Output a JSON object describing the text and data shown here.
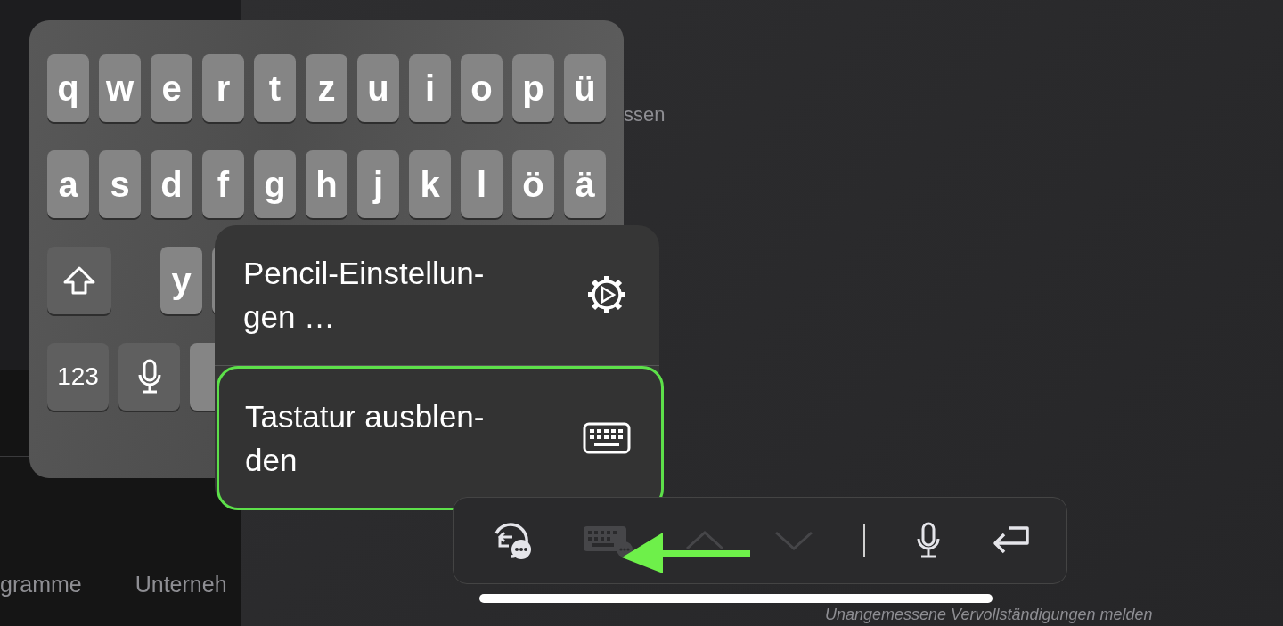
{
  "background": {
    "partial_text": "ssen",
    "nav_items": [
      "gramme",
      "Unterneh"
    ],
    "footer_link": "Unangemessene Vervollständigungen melden"
  },
  "keyboard": {
    "rows": [
      {
        "keys": [
          {
            "kind": "char",
            "label": "q"
          },
          {
            "kind": "char",
            "label": "w"
          },
          {
            "kind": "char",
            "label": "e"
          },
          {
            "kind": "char",
            "label": "r"
          },
          {
            "kind": "char",
            "label": "t"
          },
          {
            "kind": "char",
            "label": "z"
          },
          {
            "kind": "char",
            "label": "u"
          },
          {
            "kind": "char",
            "label": "i"
          },
          {
            "kind": "char",
            "label": "o"
          },
          {
            "kind": "char",
            "label": "p"
          },
          {
            "kind": "char",
            "label": "ü"
          }
        ]
      },
      {
        "keys": [
          {
            "kind": "char",
            "label": "a"
          },
          {
            "kind": "char",
            "label": "s"
          },
          {
            "kind": "char",
            "label": "d"
          },
          {
            "kind": "char",
            "label": "f"
          },
          {
            "kind": "char",
            "label": "g"
          },
          {
            "kind": "char",
            "label": "h"
          },
          {
            "kind": "char",
            "label": "j"
          },
          {
            "kind": "char",
            "label": "k"
          },
          {
            "kind": "char",
            "label": "l"
          },
          {
            "kind": "char",
            "label": "ö"
          },
          {
            "kind": "char",
            "label": "ä"
          }
        ]
      },
      {
        "keys": [
          {
            "kind": "shift"
          },
          {
            "kind": "gap"
          },
          {
            "kind": "char",
            "label": "y"
          },
          {
            "kind": "blank"
          }
        ]
      },
      {
        "keys": [
          {
            "kind": "numbers",
            "label": "123"
          },
          {
            "kind": "mic"
          },
          {
            "kind": "blank"
          }
        ]
      }
    ]
  },
  "menu": {
    "items": [
      {
        "lines": [
          "Pencil-Einstellun-",
          "gen …"
        ],
        "kind": "settings",
        "selected": false
      },
      {
        "lines": [
          "Tastatur ausblen-",
          "den"
        ],
        "kind": "hide-keyboard",
        "selected": true
      }
    ]
  },
  "toolbar": {
    "items": [
      {
        "kind": "undo",
        "disabled": false
      },
      {
        "kind": "keyboard",
        "disabled": true
      },
      {
        "kind": "up",
        "disabled": true
      },
      {
        "kind": "down",
        "disabled": true
      },
      {
        "kind": "divider"
      },
      {
        "kind": "mic",
        "disabled": false
      },
      {
        "kind": "return",
        "disabled": false
      }
    ]
  }
}
